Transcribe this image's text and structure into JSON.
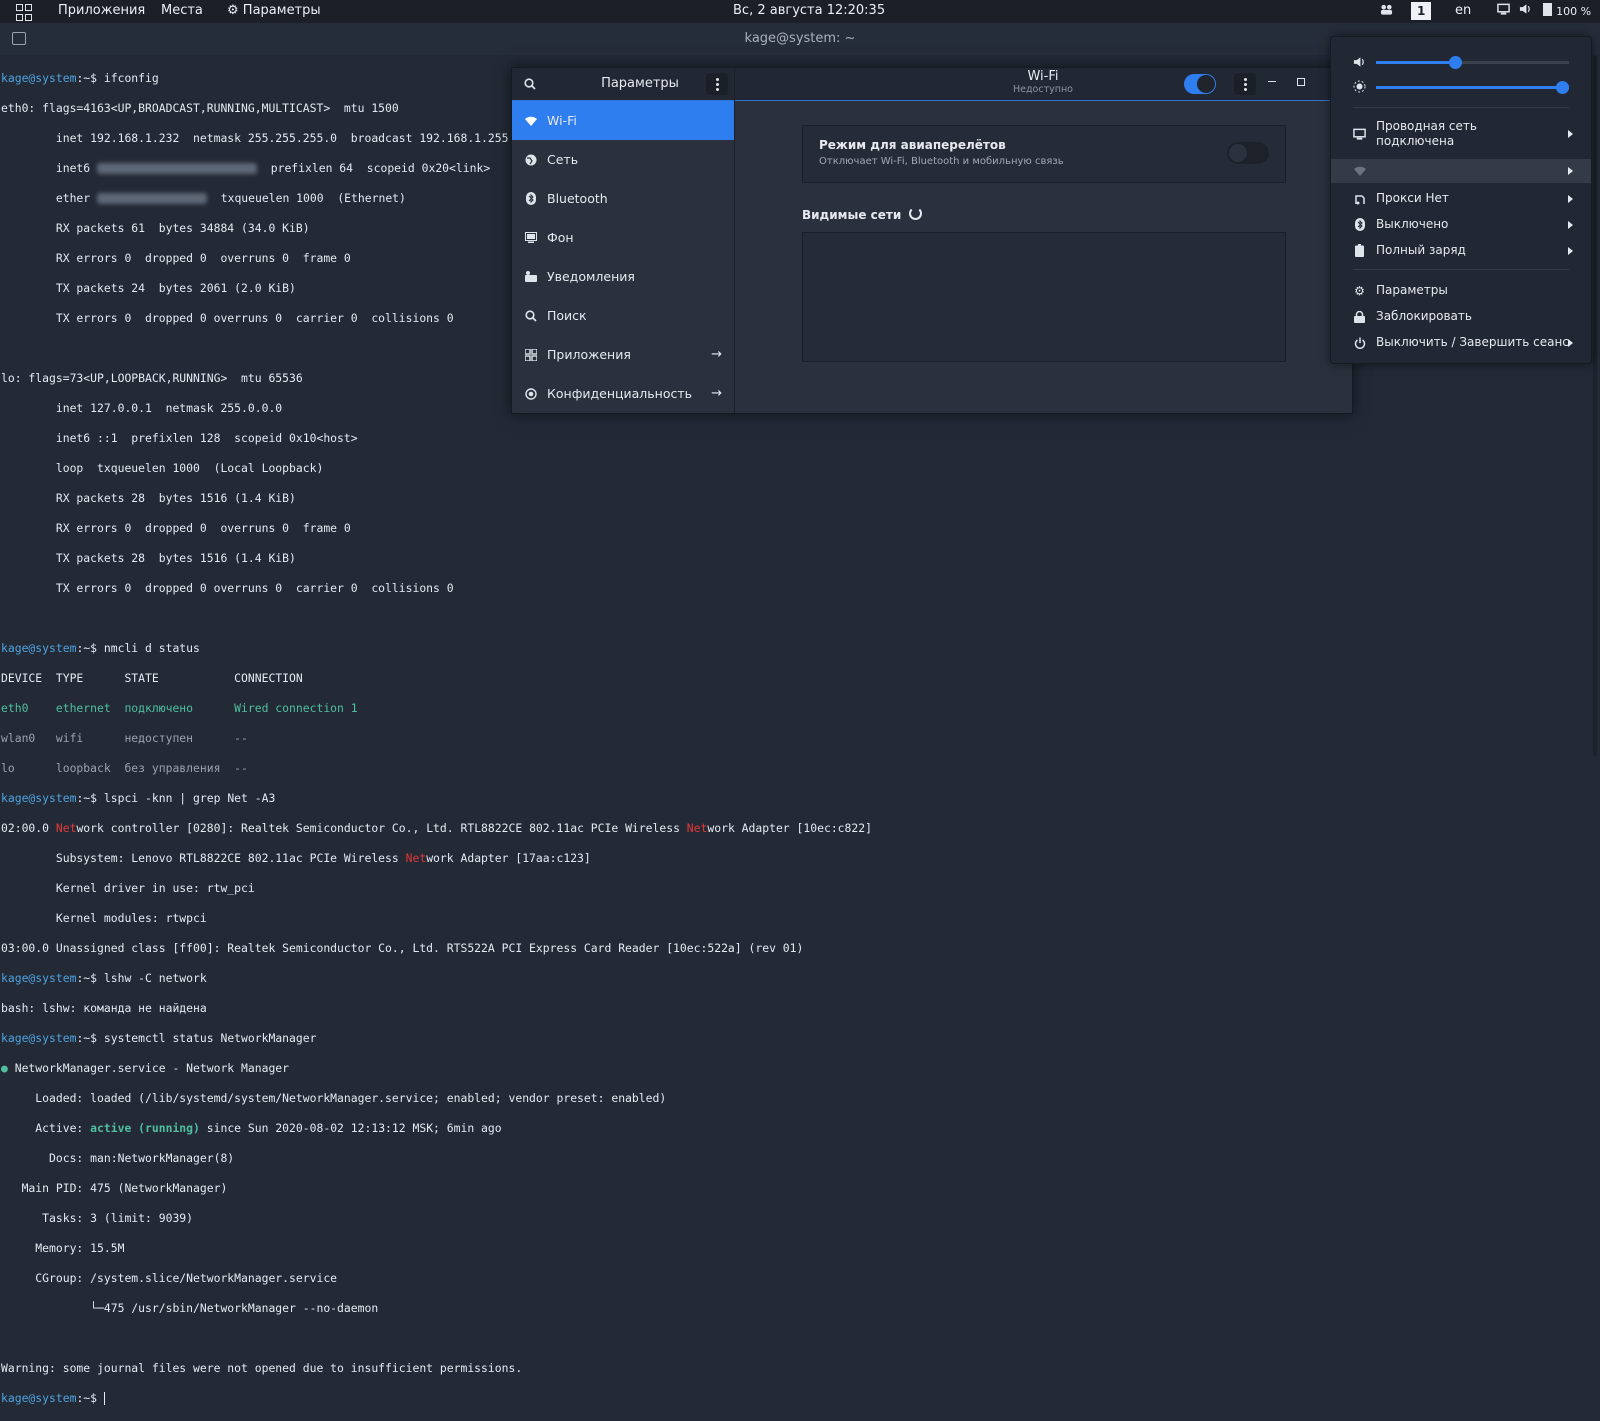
{
  "topbar": {
    "apps": "Приложения",
    "places": "Места",
    "settings": "Параметры",
    "datetime": "Вс, 2 августа  12:20:35",
    "workspace": "1",
    "lang": "en",
    "battery": "100 %"
  },
  "terminal": {
    "title": "kage@system: ~",
    "prompt": "kage@system",
    "prompt_suffix": ":~$",
    "cmd_ifconfig": " ifconfig",
    "eth0_1": "eth0: flags=4163<UP,BROADCAST,RUNNING,MULTICAST>  mtu 1500",
    "eth0_2": "        inet 192.168.1.232  netmask 255.255.255.0  broadcast 192.168.1.255",
    "eth0_3a": "        inet6 ",
    "eth0_3b": "  prefixlen 64  scopeid 0x20<link>",
    "eth0_4a": "        ether ",
    "eth0_4b": "  txqueuelen 1000  (Ethernet)",
    "eth0_5": "        RX packets 61  bytes 34884 (34.0 KiB)",
    "eth0_6": "        RX errors 0  dropped 0  overruns 0  frame 0",
    "eth0_7": "        TX packets 24  bytes 2061 (2.0 KiB)",
    "eth0_8": "        TX errors 0  dropped 0 overruns 0  carrier 0  collisions 0",
    "lo_1": "lo: flags=73<UP,LOOPBACK,RUNNING>  mtu 65536",
    "lo_2": "        inet 127.0.0.1  netmask 255.0.0.0",
    "lo_3": "        inet6 ::1  prefixlen 128  scopeid 0x10<host>",
    "lo_4": "        loop  txqueuelen 1000  (Local Loopback)",
    "lo_5": "        RX packets 28  bytes 1516 (1.4 KiB)",
    "lo_6": "        RX errors 0  dropped 0  overruns 0  frame 0",
    "lo_7": "        TX packets 28  bytes 1516 (1.4 KiB)",
    "lo_8": "        TX errors 0  dropped 0 overruns 0  carrier 0  collisions 0",
    "cmd_nmcli": " nmcli d status",
    "nm_header": "DEVICE  TYPE      STATE           CONNECTION",
    "nm_eth0": "eth0    ethernet  подключено      Wired connection 1",
    "nm_wlan0": "wlan0   wifi      недоступен      --",
    "nm_lo": "lo      loopback  без управления  --",
    "cmd_lspci": " lspci -knn | grep Net -A3",
    "lspci_1a": "02:00.0 ",
    "lspci_1b": "work controller [0280]: Realtek Semiconductor Co., Ltd. RTL8822CE 802.11ac PCIe Wireless ",
    "lspci_1c": "work Adapter [10ec:c822]",
    "lspci_2a": "        Subsystem: Lenovo RTL8822CE 802.11ac PCIe Wireless ",
    "lspci_2b": "work Adapter [17aa:c123]",
    "lspci_3": "        Kernel driver in use: rtw_pci",
    "lspci_4": "        Kernel modules: rtwpci",
    "lspci_5": "03:00.0 Unassigned class [ff00]: Realtek Semiconductor Co., Ltd. RTS522A PCI Express Card Reader [10ec:522a] (rev 01)",
    "net_hl": "Net",
    "cmd_lshw": " lshw -C network",
    "lshw_err": "bash: lshw: команда не найдена",
    "cmd_systemctl": " systemctl status NetworkManager",
    "sc_1": " NetworkManager.service - Network Manager",
    "sc_2": "     Loaded: loaded (/lib/systemd/system/NetworkManager.service; enabled; vendor preset: enabled)",
    "sc_3a": "     Active: ",
    "sc_3b": "active (running)",
    "sc_3c": " since Sun 2020-08-02 12:13:12 MSK; 6min ago",
    "sc_4": "       Docs: man:NetworkManager(8)",
    "sc_5": "   Main PID: 475 (NetworkManager)",
    "sc_6": "      Tasks: 3 (limit: 9039)",
    "sc_7": "     Memory: 15.5M",
    "sc_8": "     CGroup: /system.slice/NetworkManager.service",
    "sc_9": "             └─475 /usr/sbin/NetworkManager --no-daemon",
    "warning": "Warning: some journal files were not opened due to insufficient permissions."
  },
  "settings": {
    "title": "Параметры",
    "panel_title": "Wi-Fi",
    "panel_subtitle": "Недоступно",
    "wifi_enabled": true,
    "sidebar": [
      {
        "label": "Wi-Fi",
        "icon": "wifi-icon",
        "active": true
      },
      {
        "label": "Сеть",
        "icon": "network-icon"
      },
      {
        "label": "Bluetooth",
        "icon": "bluetooth-icon"
      },
      {
        "label": "Фон",
        "icon": "background-icon"
      },
      {
        "label": "Уведомления",
        "icon": "notifications-icon"
      },
      {
        "label": "Поиск",
        "icon": "search-icon"
      },
      {
        "label": "Приложения",
        "icon": "apps-icon",
        "arrow": true
      },
      {
        "label": "Конфиденциальность",
        "icon": "privacy-icon",
        "arrow": true
      }
    ],
    "airplane_title": "Режим для авиаперелётов",
    "airplane_desc": "Отключает Wi-Fi, Bluetooth и мобильную связь",
    "airplane_enabled": false,
    "visible_networks": "Видимые сети"
  },
  "sysmenu": {
    "volume_level": 0.41,
    "brightness_level": 1.0,
    "wired_line1": "Проводная сеть",
    "wired_line2": "подключена",
    "proxy": "Прокси Нет",
    "bluetooth": "Выключено",
    "battery": "Полный заряд",
    "settings": "Параметры",
    "lock": "Заблокировать",
    "power": "Выключить / Завершить сеанс"
  },
  "colors": {
    "accent": "#2f7ef0",
    "prompt_user": "#4fa3e0",
    "terminal_green": "#4fbf9f",
    "highlight_red": "#e23838"
  }
}
